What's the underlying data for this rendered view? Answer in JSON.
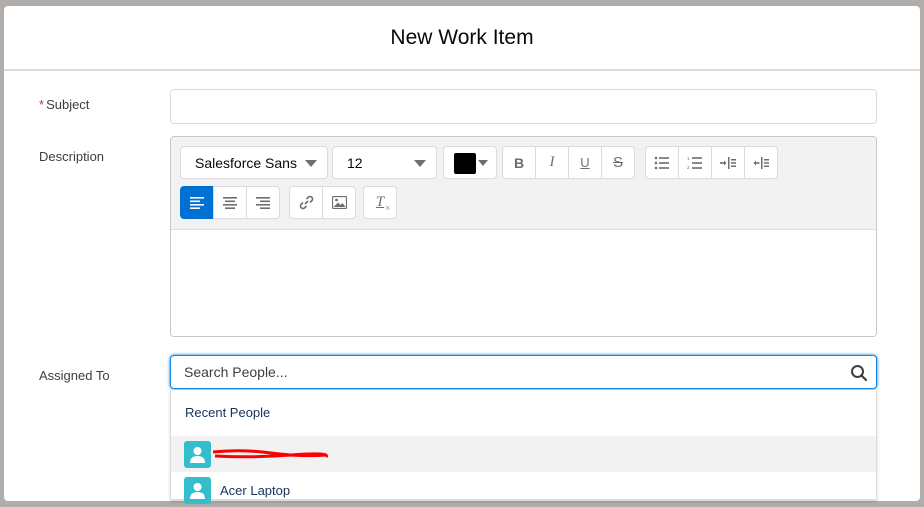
{
  "modal": {
    "title": "New Work Item"
  },
  "form": {
    "subject": {
      "required_mark": "*",
      "label": "Subject",
      "value": ""
    },
    "description": {
      "label": "Description",
      "value": ""
    },
    "assigned_to": {
      "label": "Assigned To",
      "placeholder": "Search People..."
    }
  },
  "editor": {
    "font_family": "Salesforce Sans",
    "font_size": "12",
    "text_color": "#000000",
    "format_buttons": [
      "bold-icon",
      "italic-icon",
      "underline-icon",
      "strikethrough-icon"
    ],
    "list_buttons": [
      "bulleted-list-icon",
      "numbered-list-icon",
      "indent-icon",
      "outdent-icon"
    ],
    "align_buttons": [
      "align-left-icon",
      "align-center-icon",
      "align-right-icon"
    ],
    "active_align": "align-left",
    "insert_buttons": [
      "link-icon",
      "image-icon"
    ],
    "clear_button": "clear-formatting-icon"
  },
  "lookup": {
    "section_heading": "Recent People",
    "items": [
      {
        "name": "",
        "redacted": true,
        "highlighted": true,
        "icon": "user-icon"
      },
      {
        "name": "Acer Laptop",
        "redacted": false,
        "highlighted": false,
        "icon": "user-icon"
      }
    ]
  },
  "colors": {
    "accent": "#0070d2",
    "avatar": "#34becd",
    "focus_border": "#1589ee",
    "required": "#c23934"
  }
}
